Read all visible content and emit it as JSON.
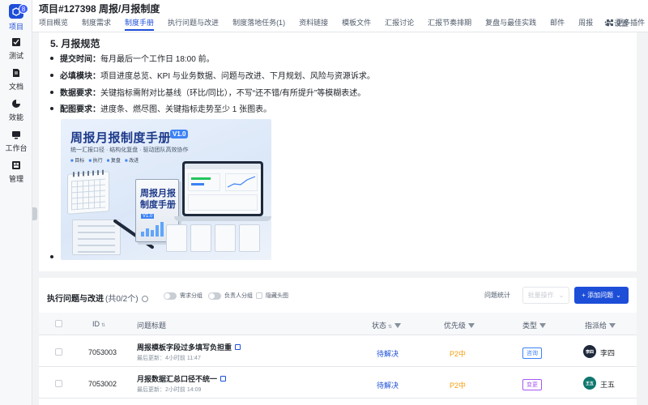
{
  "sidebar": {
    "items": [
      {
        "label": "项目",
        "icon": "project-icon",
        "badge": "8",
        "active": true
      },
      {
        "label": "测试",
        "icon": "test-icon"
      },
      {
        "label": "文档",
        "icon": "document-icon"
      },
      {
        "label": "效能",
        "icon": "pie-chart-icon"
      },
      {
        "label": "工作台",
        "icon": "monitor-icon"
      },
      {
        "label": "管理",
        "icon": "admin-icon"
      }
    ]
  },
  "header": {
    "title": "项目#127398 周报/月报制度",
    "tabs": [
      "项目概览",
      "制度需求",
      "制度手册",
      "执行问题与改进",
      "制度落地任务(1)",
      "资料链接",
      "模板文件",
      "汇报讨论",
      "汇报节奏排期",
      "复盘与最佳实践",
      "邮件",
      "周报",
      "更多插件"
    ],
    "active_tab": "制度手册",
    "settings_label": "设置"
  },
  "doc": {
    "heading": "5. 月报规范",
    "bullets": [
      {
        "label": "提交时间：",
        "text": "每月最后一个工作日 18:00 前。"
      },
      {
        "label": "必填模块：",
        "text": "项目进度总览、KPI 与业务数据、问题与改进、下月规划、风险与资源诉求。"
      },
      {
        "label": "数据要求：",
        "text": "关键指标需附对比基线（环比/同比），不写“还不错/有所提升”等模糊表述。"
      },
      {
        "label": "配图要求：",
        "text": "进度条、燃尽图、关键指标走势至少 1 张图表。"
      }
    ],
    "image": {
      "title": "周报月报制度手册",
      "version": "V1.0",
      "subtitle": "统一汇报口径 · 结构化复盘 · 驱动团队高效协作",
      "tags": [
        "目标",
        "执行",
        "复盘",
        "改进"
      ],
      "book_title_line1": "周报月报",
      "book_title_line2": "制度手册",
      "book_version": "V1.0"
    }
  },
  "issues": {
    "title": "执行问题与改进",
    "count": "(共0/2个)",
    "toggle_group": "需求分组",
    "toggle_owner": "负责人分组",
    "hide_empty": "隐藏头图",
    "stats_label": "问题统计",
    "batch_label": "批量操作",
    "add_label": "+ 添加问题",
    "columns": {
      "id": "ID",
      "title": "问题标题",
      "status": "状态",
      "priority": "优先级",
      "type": "类型",
      "assignee": "指派给"
    },
    "rows": [
      {
        "id": "7053003",
        "title": "周报模板字段过多填写负担重",
        "updated": "最后更新：4小时前 11:47",
        "status": "待解决",
        "priority": "P2中",
        "type": "咨询",
        "type_color": "#3b82f6",
        "avatar": "李四",
        "avatar_color": "#1e293b",
        "assignee": "李四"
      },
      {
        "id": "7053002",
        "title": "月报数据汇总口径不统一",
        "updated": "最后更新：2小时前 14:09",
        "status": "待解决",
        "priority": "P2中",
        "type": "变更",
        "type_color": "#a855f7",
        "avatar": "王五",
        "avatar_color": "#0f766e",
        "assignee": "王五"
      }
    ]
  }
}
